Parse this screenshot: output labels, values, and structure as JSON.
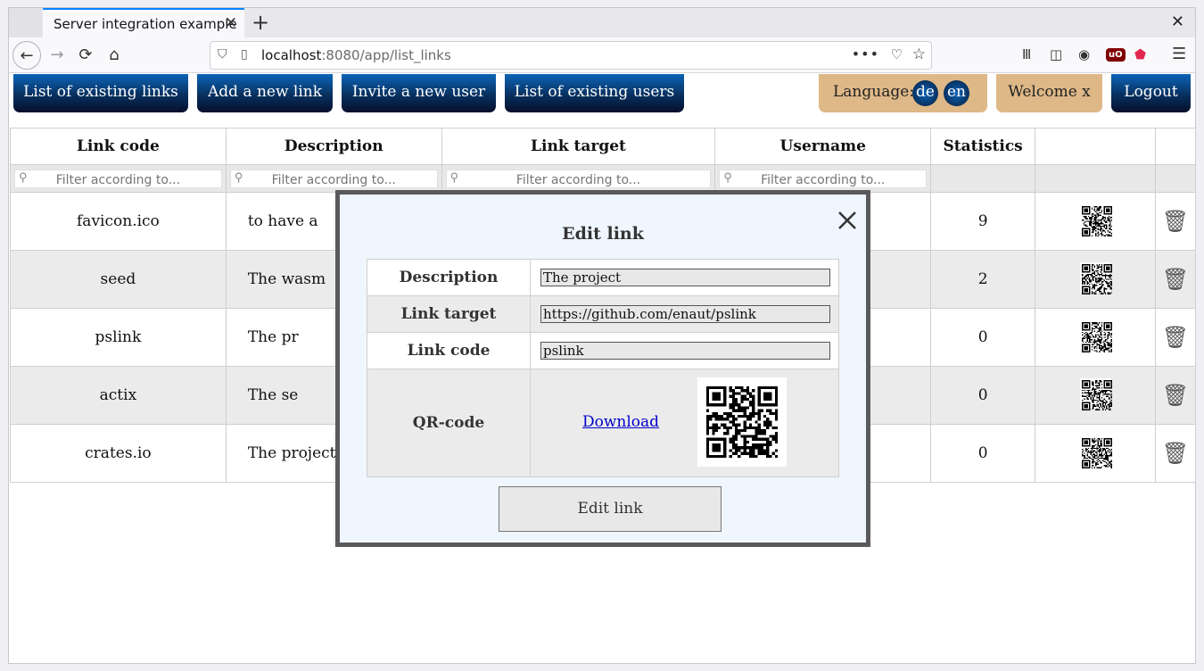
{
  "browser": {
    "tab_title": "Server integration example",
    "tab_close": "✕",
    "new_tab": "+",
    "window_close": "✕",
    "url_host": "localhost",
    "url_path": ":8080/app/list_links",
    "url_more": "•••"
  },
  "nav": {
    "list_links": "List of existing links",
    "add_link": "Add a new link",
    "invite_user": "Invite a new user",
    "list_users": "List of existing users",
    "language_label": "Language:",
    "lang_de": "de",
    "lang_en": "en",
    "welcome": "Welcome x",
    "logout": "Logout"
  },
  "table": {
    "headers": [
      "Link code",
      "Description",
      "Link target",
      "Username",
      "Statistics"
    ],
    "filter_placeholder": "Filter according to...",
    "rows": [
      {
        "code": "favicon.ico",
        "description": "to have a",
        "statistics": "9"
      },
      {
        "code": "seed",
        "description": "The wasm",
        "statistics": "2"
      },
      {
        "code": "pslink",
        "description": "The pr",
        "statistics": "0"
      },
      {
        "code": "actix",
        "description": "The se",
        "statistics": "0"
      },
      {
        "code": "crates.io",
        "description": "The project",
        "statistics": "0"
      }
    ]
  },
  "modal": {
    "title": "Edit link",
    "labels": {
      "description": "Description",
      "target": "Link target",
      "code": "Link code",
      "qr": "QR-code"
    },
    "values": {
      "description": "The project",
      "target": "https://github.com/enaut/pslink",
      "code": "pslink"
    },
    "download": "Download",
    "submit": "Edit link"
  },
  "icons": {
    "back": "arrow-left-icon",
    "forward": "arrow-right-icon",
    "reload": "reload-icon",
    "home": "home-icon",
    "delete": "trash-icon",
    "close": "close-icon"
  }
}
